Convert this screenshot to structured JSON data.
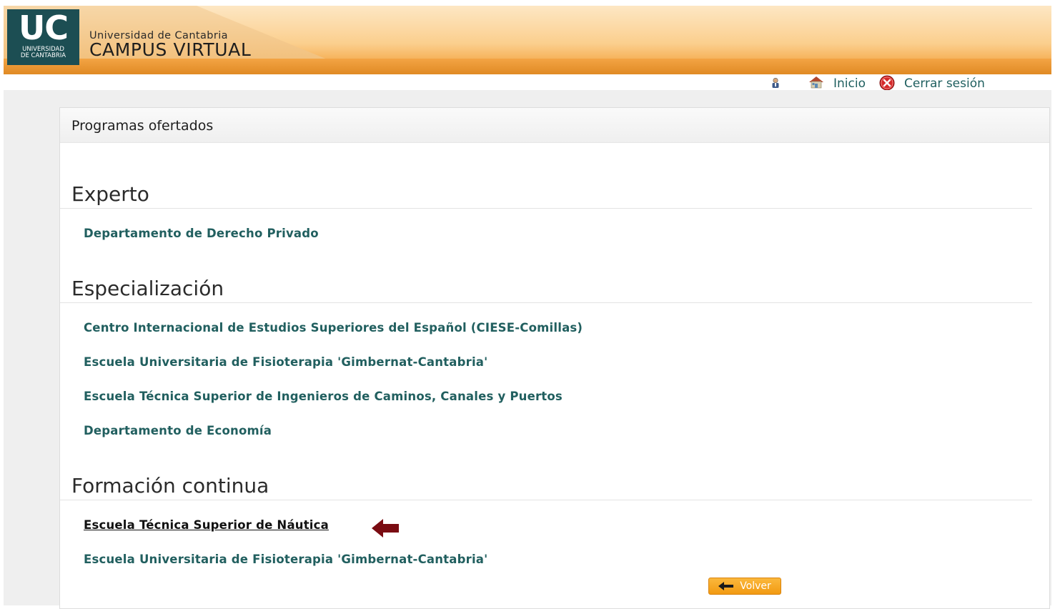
{
  "header": {
    "logo_text": "UC",
    "logo_subtitle_line1": "UNIVERSIDAD",
    "logo_subtitle_line2": "DE CANTABRIA",
    "university": "Universidad de Cantabria",
    "site": "CAMPUS VIRTUAL"
  },
  "topnav": {
    "home_label": "Inicio",
    "logout_label": "Cerrar sesión"
  },
  "panel": {
    "title": "Programas ofertados",
    "sections": [
      {
        "title": "Experto",
        "links": [
          "Departamento de Derecho Privado"
        ]
      },
      {
        "title": "Especialización",
        "links": [
          "Centro Internacional de Estudios Superiores del Español (CIESE-Comillas)",
          "Escuela Universitaria de Fisioterapia 'Gimbernat-Cantabria'",
          "Escuela Técnica Superior de Ingenieros de Caminos, Canales y Puertos",
          "Departamento de Economía"
        ]
      },
      {
        "title": "Formación continua",
        "links": [
          "Escuela Técnica Superior de Náutica",
          "Escuela Universitaria de Fisioterapia 'Gimbernat-Cantabria'"
        ]
      }
    ],
    "back_label": "Volver"
  },
  "colors": {
    "link": "#215f5f",
    "header_orange": "#f6b25a",
    "logo_bg": "#1c4e53",
    "arrow": "#7a0c12",
    "button": "#f29a12"
  }
}
